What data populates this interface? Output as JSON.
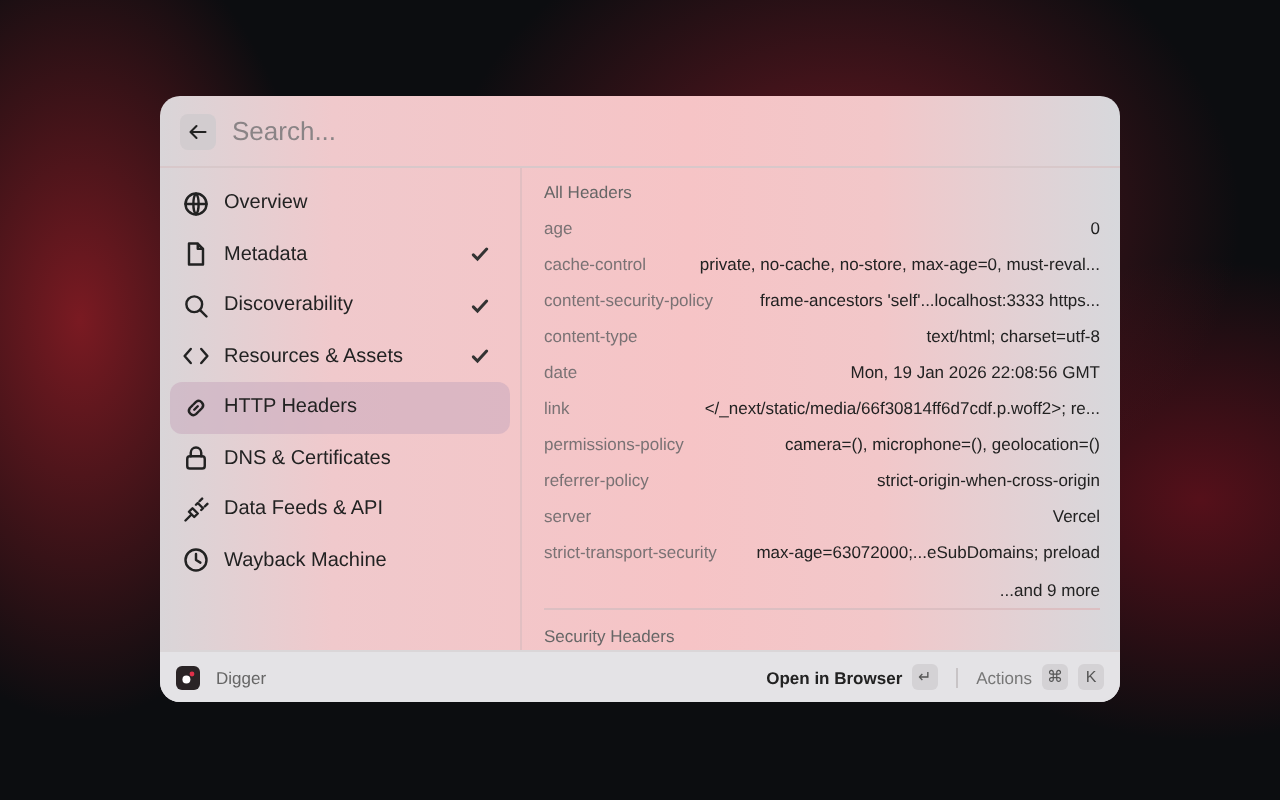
{
  "search": {
    "placeholder": "Search..."
  },
  "sidebar": {
    "items": [
      {
        "label": "Overview",
        "checked": false,
        "selected": false
      },
      {
        "label": "Metadata",
        "checked": true,
        "selected": false
      },
      {
        "label": "Discoverability",
        "checked": true,
        "selected": false
      },
      {
        "label": "Resources & Assets",
        "checked": true,
        "selected": false
      },
      {
        "label": "HTTP Headers",
        "checked": false,
        "selected": true
      },
      {
        "label": "DNS & Certificates",
        "checked": false,
        "selected": false
      },
      {
        "label": "Data Feeds & API",
        "checked": false,
        "selected": false
      },
      {
        "label": "Wayback Machine",
        "checked": false,
        "selected": false
      }
    ]
  },
  "content": {
    "sections": [
      {
        "title": "All Headers",
        "rows": [
          {
            "name": "age",
            "value": "0"
          },
          {
            "name": "cache-control",
            "value": "private, no-cache, no-store, max-age=0, must-reval..."
          },
          {
            "name": "content-security-policy",
            "value": "frame-ancestors 'self'...localhost:3333 https..."
          },
          {
            "name": "content-type",
            "value": "text/html; charset=utf-8"
          },
          {
            "name": "date",
            "value": "Mon, 19 Jan 2026 22:08:56 GMT"
          },
          {
            "name": "link",
            "value": "</_next/static/media/66f30814ff6d7cdf.p.woff2>; re..."
          },
          {
            "name": "permissions-policy",
            "value": "camera=(), microphone=(), geolocation=()"
          },
          {
            "name": "referrer-policy",
            "value": "strict-origin-when-cross-origin"
          },
          {
            "name": "server",
            "value": "Vercel"
          },
          {
            "name": "strict-transport-security",
            "value": "max-age=63072000;...eSubDomains; preload"
          }
        ],
        "more": "...and 9 more"
      },
      {
        "title": "Security Headers"
      }
    ]
  },
  "footer": {
    "app_name": "Digger",
    "primary_action": "Open in Browser",
    "primary_key": "↵",
    "actions_label": "Actions",
    "action_keys": [
      "⌘",
      "K"
    ]
  }
}
